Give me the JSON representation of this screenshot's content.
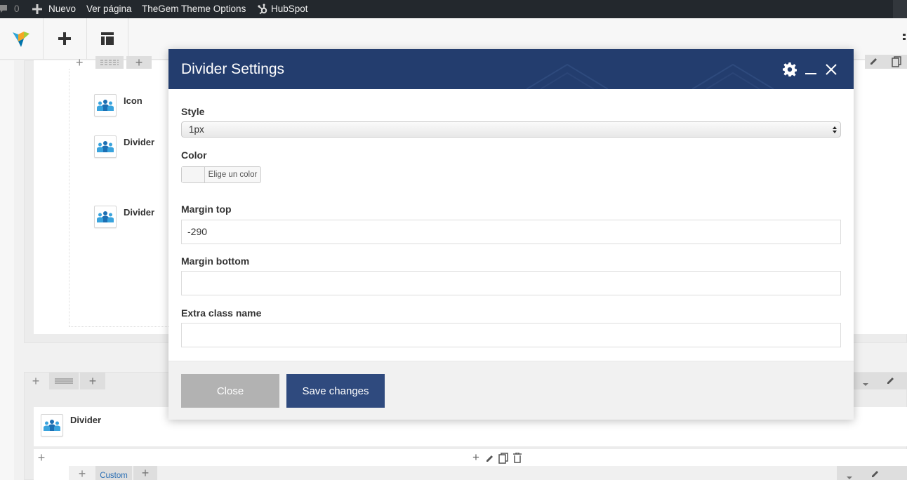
{
  "adminbar": {
    "comments_count": "0",
    "new_label": "Nuevo",
    "view_page_label": "Ver página",
    "theme_options_label": "TheGem Theme Options",
    "hubspot_label": "HubSpot"
  },
  "canvas": {
    "elements": [
      {
        "label": "Icon"
      },
      {
        "label": "Divider"
      },
      {
        "label": "Divider"
      },
      {
        "label": "Divider"
      }
    ],
    "custom_tab": "Custom"
  },
  "modal": {
    "title": "Divider Settings",
    "fields": {
      "style": {
        "label": "Style",
        "value": "1px"
      },
      "color": {
        "label": "Color",
        "button_label": "Elige un color"
      },
      "margin_top": {
        "label": "Margin top",
        "value": "-290"
      },
      "margin_bottom": {
        "label": "Margin bottom",
        "value": ""
      },
      "extra_class": {
        "label": "Extra class name",
        "value": ""
      }
    },
    "buttons": {
      "close": "Close",
      "save": "Save changes"
    }
  },
  "colors": {
    "adminbar_bg": "#23282d",
    "modal_header": "#233d6e",
    "save_button": "#2f4a7e",
    "close_button": "#b2b2b2",
    "custom_tab_text": "#2b6fb4"
  }
}
